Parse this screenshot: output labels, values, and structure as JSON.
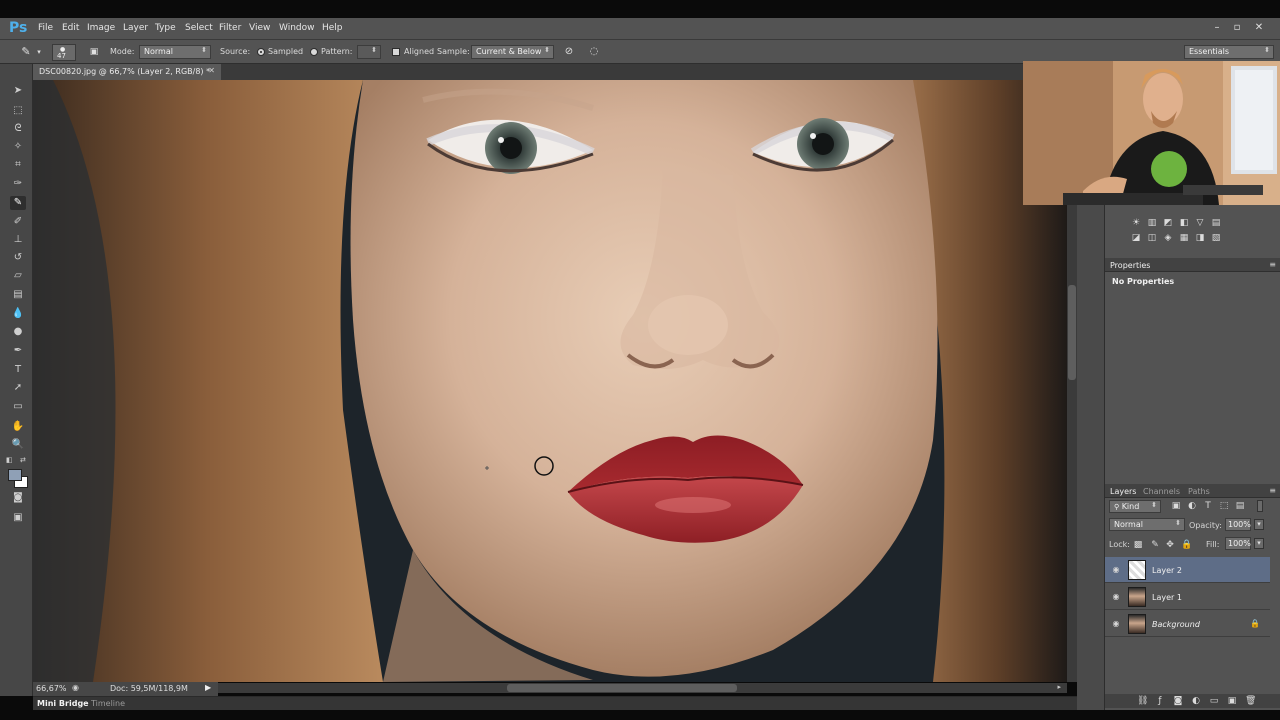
{
  "app": {
    "logo": "Ps"
  },
  "menu": [
    "File",
    "Edit",
    "Image",
    "Layer",
    "Type",
    "Select",
    "Filter",
    "View",
    "Window",
    "Help"
  ],
  "options_bar": {
    "brush_size": "47",
    "mode_label": "Mode:",
    "mode_value": "Normal",
    "source_label": "Source:",
    "sampled_label": "Sampled",
    "pattern_label": "Pattern:",
    "aligned_label": "Aligned",
    "sample_label": "Sample:",
    "sample_value": "Current & Below",
    "workspace": "Essentials"
  },
  "document": {
    "tab_title": "DSC00820.jpg @ 66,7% (Layer 2, RGB/8) *",
    "zoom": "66,67%",
    "doc_size": "Doc: 59,5M/118,9M"
  },
  "bottom_tabs": [
    "Mini Bridge",
    "Timeline"
  ],
  "properties": {
    "tab": "Properties",
    "content": "No Properties"
  },
  "layers_panel": {
    "tabs": [
      "Layers",
      "Channels",
      "Paths"
    ],
    "kind_label": "Kind",
    "blend_mode": "Normal",
    "opacity_label": "Opacity:",
    "opacity_value": "100%",
    "lock_label": "Lock:",
    "fill_label": "Fill:",
    "fill_value": "100%",
    "layers": [
      {
        "name": "Layer 2",
        "selected": true
      },
      {
        "name": "Layer 1",
        "selected": false
      },
      {
        "name": "Background",
        "selected": false,
        "locked": true
      }
    ]
  },
  "colors": {
    "ui_bg": "#535353",
    "selection": "#5e6d87",
    "logo": "#4fb0ea"
  }
}
